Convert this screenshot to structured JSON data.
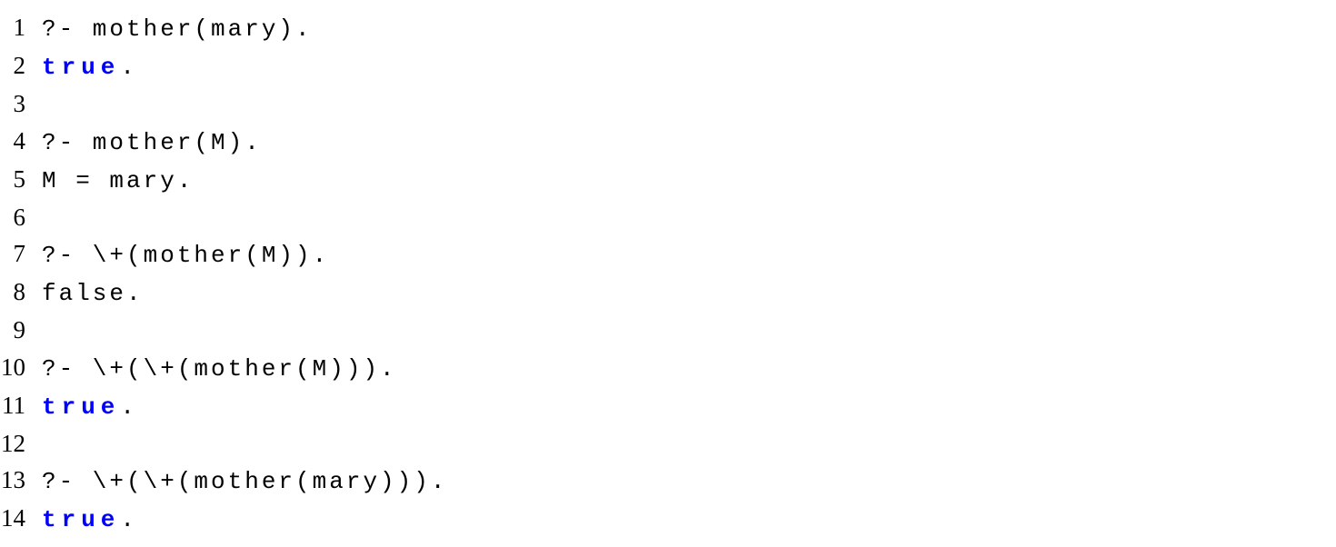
{
  "lines": [
    {
      "num": "1",
      "segments": [
        {
          "text": "?- mother(mary).",
          "cls": ""
        }
      ]
    },
    {
      "num": "2",
      "segments": [
        {
          "text": "true",
          "cls": "keyword"
        },
        {
          "text": ".",
          "cls": ""
        }
      ]
    },
    {
      "num": "3",
      "segments": [
        {
          "text": "",
          "cls": ""
        }
      ]
    },
    {
      "num": "4",
      "segments": [
        {
          "text": "?- mother(M).",
          "cls": ""
        }
      ]
    },
    {
      "num": "5",
      "segments": [
        {
          "text": "M = mary.",
          "cls": ""
        }
      ]
    },
    {
      "num": "6",
      "segments": [
        {
          "text": "",
          "cls": ""
        }
      ]
    },
    {
      "num": "7",
      "segments": [
        {
          "text": "?- \\+(mother(M)).",
          "cls": ""
        }
      ]
    },
    {
      "num": "8",
      "segments": [
        {
          "text": "false.",
          "cls": ""
        }
      ]
    },
    {
      "num": "9",
      "segments": [
        {
          "text": "",
          "cls": ""
        }
      ]
    },
    {
      "num": "10",
      "segments": [
        {
          "text": "?- \\+(\\+(mother(M))).",
          "cls": ""
        }
      ]
    },
    {
      "num": "11",
      "segments": [
        {
          "text": "true",
          "cls": "keyword"
        },
        {
          "text": ".",
          "cls": ""
        }
      ]
    },
    {
      "num": "12",
      "segments": [
        {
          "text": "",
          "cls": ""
        }
      ]
    },
    {
      "num": "13",
      "segments": [
        {
          "text": "?- \\+(\\+(mother(mary))).",
          "cls": ""
        }
      ]
    },
    {
      "num": "14",
      "segments": [
        {
          "text": "true",
          "cls": "keyword"
        },
        {
          "text": ".",
          "cls": ""
        }
      ]
    }
  ]
}
